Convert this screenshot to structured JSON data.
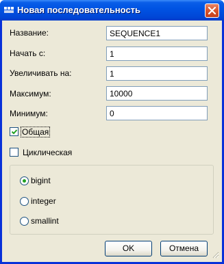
{
  "window": {
    "title": "Новая последовательность"
  },
  "form": {
    "name_label": "Название:",
    "name_value": "SEQUENCE1",
    "start_label": "Начать с:",
    "start_value": "1",
    "increment_label": "Увеличивать на:",
    "increment_value": "1",
    "max_label": "Максимум:",
    "max_value": "10000",
    "min_label": "Минимум:",
    "min_value": "0",
    "shared_label": "Общая",
    "shared_checked": true,
    "cyclic_label": "Циклическая",
    "cyclic_checked": false
  },
  "type_group": {
    "options": [
      "bigint",
      "integer",
      "smallint"
    ],
    "selected": "bigint"
  },
  "buttons": {
    "ok": "OK",
    "cancel": "Отмена"
  },
  "colors": {
    "titlebar": "#0054e3",
    "client": "#ece9d8",
    "close": "#d9542c",
    "radio_dot": "#21a121"
  }
}
